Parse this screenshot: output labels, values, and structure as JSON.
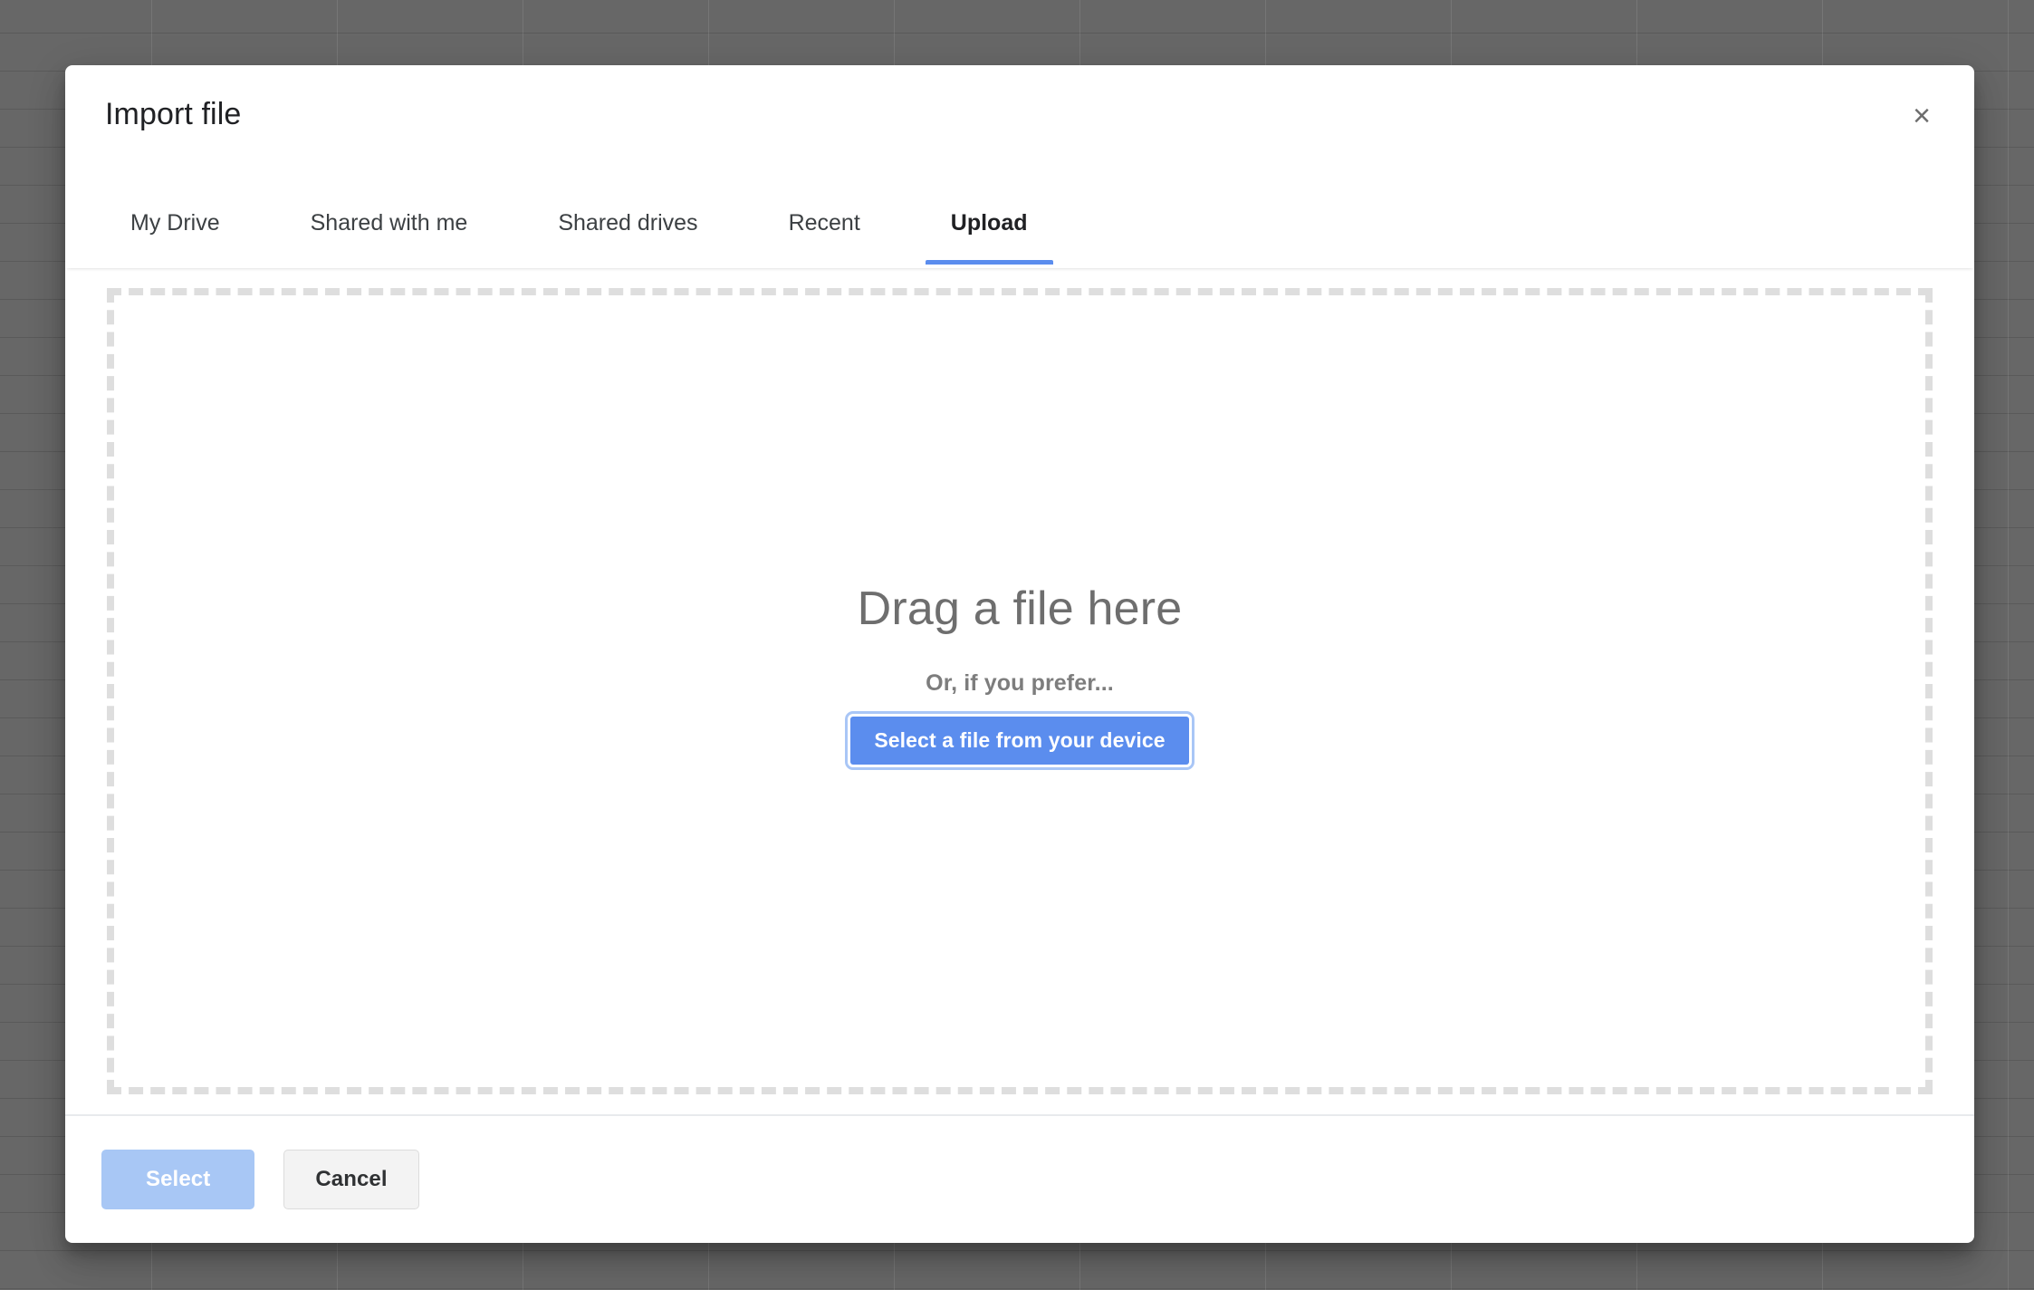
{
  "dialog": {
    "title": "Import file",
    "close_icon_label": "×"
  },
  "tabs": [
    {
      "label": "My Drive",
      "active": false
    },
    {
      "label": "Shared with me",
      "active": false
    },
    {
      "label": "Shared drives",
      "active": false
    },
    {
      "label": "Recent",
      "active": false
    },
    {
      "label": "Upload",
      "active": true
    }
  ],
  "dropzone": {
    "headline": "Drag a file here",
    "subtext": "Or, if you prefer...",
    "button_label": "Select a file from your device"
  },
  "footer": {
    "select_label": "Select",
    "cancel_label": "Cancel"
  },
  "colors": {
    "accent": "#5b8dee",
    "accent_disabled": "#a8c7f5",
    "focus_ring": "#a9c6f6",
    "dashed_border": "#dedede",
    "backdrop": "#676767",
    "text_primary": "#202124",
    "text_muted": "#6e6e6e"
  }
}
